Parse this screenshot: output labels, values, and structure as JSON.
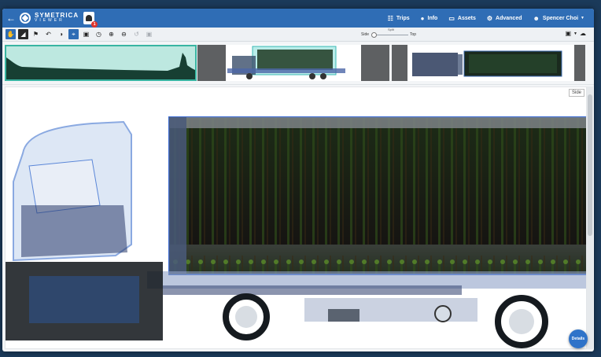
{
  "nav": {
    "back_icon": "arrow-left-icon",
    "brand_name": "SYMETRICA",
    "brand_sub": "VIEWER",
    "notification_count": "1",
    "links": [
      {
        "label": "Trips",
        "icon": "trips-icon"
      },
      {
        "label": "Info",
        "icon": "info-icon"
      },
      {
        "label": "Assets",
        "icon": "monitor-icon"
      },
      {
        "label": "Advanced",
        "icon": "gear-icon"
      },
      {
        "label": "Spencer Choi",
        "icon": "user-icon"
      }
    ],
    "colors": {
      "bar": "#2f6db5",
      "badge": "#e0342b"
    }
  },
  "toolbar": {
    "tools": [
      "pan-icon",
      "contrast-mode-icon",
      "flag-icon",
      "undo-icon",
      "half-circle-icon",
      "crop-icon",
      "box-icon",
      "history-icon",
      "zoom-in-icon",
      "zoom-out-icon",
      "reset-view-icon",
      "lock-icon"
    ],
    "split_title": "Split",
    "split_left": "Side",
    "split_right": "Top",
    "save_icon": "save-icon",
    "cloud_icon": "cloud-download-icon"
  },
  "viewer": {
    "view_label": "Side",
    "details_label": "Details"
  }
}
